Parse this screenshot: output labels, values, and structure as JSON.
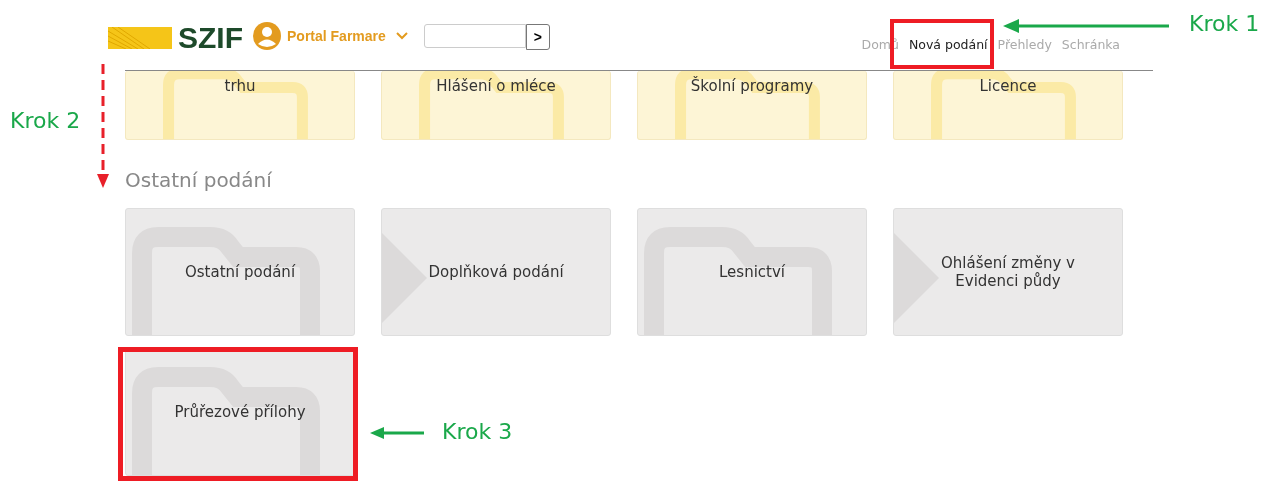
{
  "header": {
    "logo_text": "SZIF",
    "portal_menu": {
      "label": "Portal Farmare"
    },
    "search": {
      "button_label": ">"
    },
    "nav": [
      {
        "label": "Domů",
        "selected": false
      },
      {
        "label": "Nová podání",
        "selected": true
      },
      {
        "label": "Přehledy",
        "selected": false
      },
      {
        "label": "Schránka",
        "selected": false
      }
    ]
  },
  "top_tiles": [
    {
      "label": "trhu",
      "kind": "folder"
    },
    {
      "label": "Hlášení o mléce",
      "kind": "folder"
    },
    {
      "label": "Školní programy",
      "kind": "folder"
    },
    {
      "label": "Licence",
      "kind": "folder"
    }
  ],
  "section": {
    "title": "Ostatní podání",
    "tiles": [
      {
        "label": "Ostatní podání",
        "kind": "folder"
      },
      {
        "label": "Doplňková podání",
        "kind": "chevron"
      },
      {
        "label": "Lesnictví",
        "kind": "folder"
      },
      {
        "label": "Ohlášení změny v Evidenci půdy",
        "kind": "chevron"
      },
      {
        "label": "Průřezové přílohy",
        "kind": "folder"
      }
    ]
  },
  "annotations": [
    {
      "text": "Krok 1"
    },
    {
      "text": "Krok 2"
    },
    {
      "text": "Krok 3"
    }
  ]
}
